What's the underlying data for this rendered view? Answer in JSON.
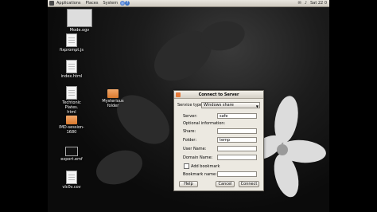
{
  "topbar": {
    "applications": "Applications",
    "places": "Places",
    "system": "System",
    "clock": "Sat 22 0"
  },
  "desktop": {
    "icons": [
      {
        "name": "Mode.ogv",
        "kind": "video"
      },
      {
        "name": "fixprompt.js",
        "kind": "doc"
      },
      {
        "name": "index.html",
        "kind": "doc"
      },
      {
        "name": "Techtonic Plates.\nhtml",
        "kind": "doc"
      },
      {
        "name": "Mysterious folder",
        "kind": "folder"
      },
      {
        "name": "IMD-session-1680",
        "kind": "folder"
      },
      {
        "name": "export.emf",
        "kind": "monitor"
      },
      {
        "name": "vlc0v.cov",
        "kind": "doc"
      }
    ]
  },
  "dialog": {
    "title": "Connect to Server",
    "service_type_label": "Service type:",
    "service_type_value": "Windows share",
    "server_label": "Server:",
    "server_value": "safe",
    "optional_label": "Optional information:",
    "share_label": "Share:",
    "share_value": "",
    "folder_label": "Folder:",
    "folder_value": "temp",
    "username_label": "User Name:",
    "username_value": "",
    "domain_label": "Domain Name:",
    "domain_value": "",
    "add_bookmark_label": "Add bookmark",
    "bookmark_name_label": "Bookmark name:",
    "bookmark_name_value": "",
    "help_label": "Help",
    "cancel_label": "Cancel",
    "connect_label": "Connect"
  },
  "colors": {
    "panel": "#e1ddd5",
    "dialog_bg": "#ece9e1",
    "folder": "#e38a45",
    "desktop": "#111111"
  }
}
